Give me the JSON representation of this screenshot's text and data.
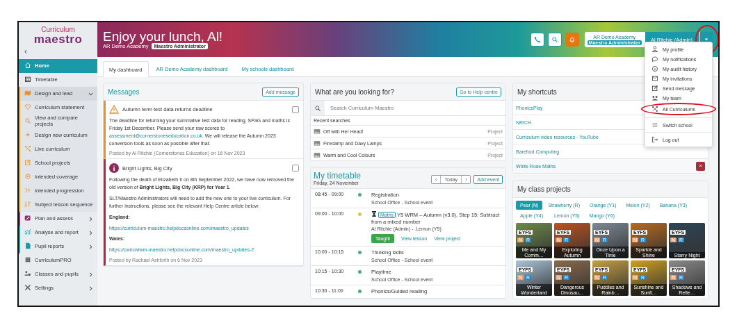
{
  "sidebar": {
    "logo": {
      "top": "Curriculum",
      "bottom": "maestro"
    },
    "collapse": "‹",
    "items": [
      {
        "label": "Home",
        "kind": "link",
        "selected": true
      },
      {
        "label": "Timetable",
        "kind": "link",
        "selected": false
      },
      {
        "label": "Design and lead",
        "kind": "group",
        "selected": false,
        "expanded": true,
        "color": "#e8912d"
      },
      {
        "label": "Curriculum statement",
        "kind": "sub",
        "selected": false
      },
      {
        "label": "View and compare projects",
        "kind": "sub",
        "selected": false
      },
      {
        "label": "Design new curriculum",
        "kind": "sub",
        "selected": false
      },
      {
        "label": "Live curriculum",
        "kind": "sub",
        "selected": false
      },
      {
        "label": "School projects",
        "kind": "sub",
        "selected": false
      },
      {
        "label": "Intended coverage",
        "kind": "sub",
        "selected": false
      },
      {
        "label": "Intended progression",
        "kind": "sub",
        "selected": false
      },
      {
        "label": "Subject lesson sequence",
        "kind": "sub",
        "selected": false
      },
      {
        "label": "Plan and assess",
        "kind": "group",
        "selected": false,
        "expanded": false,
        "color": "#8e2a6e"
      },
      {
        "label": "Analyse and report",
        "kind": "group",
        "selected": false,
        "expanded": false,
        "color": "#1a9aa8"
      },
      {
        "label": "Pupil reports",
        "kind": "group",
        "selected": false,
        "expanded": false,
        "color": "#1a9aa8"
      },
      {
        "label": "CurriculumPRO",
        "kind": "link",
        "selected": false
      },
      {
        "label": "Classes and pupils",
        "kind": "group",
        "selected": false,
        "expanded": false,
        "color": "#e9ecef"
      },
      {
        "label": "Settings",
        "kind": "group",
        "selected": false,
        "expanded": false,
        "color": "#e9ecef"
      }
    ]
  },
  "header": {
    "greeting": "Enjoy your lunch, Al!",
    "school": "AR Demo Academy",
    "role": "Maestro Administrator",
    "account": {
      "school": "AR Demo Academy",
      "role": "Maestro Administrator",
      "user": "Al Ritchie (Admin)",
      "menu_open": true,
      "highlighted": true
    }
  },
  "user_menu": {
    "sections": [
      [
        {
          "label": "My profile",
          "highlighted": false
        },
        {
          "label": "My notifications",
          "highlighted": false
        },
        {
          "label": "My audit history",
          "highlighted": false
        },
        {
          "label": "My invitations",
          "highlighted": false
        },
        {
          "label": "Send message",
          "highlighted": false
        },
        {
          "label": "My team",
          "highlighted": false
        },
        {
          "label": "All Curriculums",
          "highlighted": true
        }
      ],
      [
        {
          "label": "Switch school",
          "highlighted": false
        }
      ],
      [
        {
          "label": "Log out",
          "highlighted": false
        }
      ]
    ]
  },
  "tabs": [
    {
      "label": "My dashboard",
      "selected": true
    },
    {
      "label": "AR Demo Academy dashboard",
      "selected": false
    },
    {
      "label": "My schools dashboard",
      "selected": false
    }
  ],
  "messages": {
    "title": "Messages",
    "add_button": "Add message",
    "items": [
      {
        "kind": "warning",
        "title": "Autumn term test data returns deadline",
        "checked": false,
        "paragraphs": [
          [
            {
              "kind": "text",
              "text": "The deadline for returning your summative test data for reading, SPaG and maths is Friday 1st December. Please send your raw scores to "
            },
            {
              "kind": "link",
              "text": "assessment@cornerstoneseducation.co.uk"
            },
            {
              "kind": "text",
              "text": ". We will release the Autumn 2023 conversion tools as soon as possible after that."
            }
          ]
        ],
        "posted": "Posted by Al Ritchie (Cornerstones Education) on 16 Nov 2023"
      },
      {
        "kind": "info",
        "title": "Bright Lights, Big City",
        "checked": false,
        "paragraphs": [
          [
            {
              "kind": "text",
              "text": "Following the death of Elizabeth II on 8th September 2022, we have now removed the old version of **Bright Lights, Big City (KRP) for Year 1**."
            }
          ],
          [
            {
              "kind": "text",
              "text": "SLT/Maestro Administrators will need to add the new one to your live curriculum. For further instructions, please see the relevant Help Centre article below:"
            }
          ],
          [
            {
              "kind": "heading",
              "text": "England:"
            }
          ],
          [
            {
              "kind": "link",
              "text": "https://curriculum-maestro.helpdocsonline.com/maestro_updates"
            }
          ],
          [
            {
              "kind": "heading",
              "text": "Wales:"
            }
          ],
          [
            {
              "kind": "link",
              "text": "https://cwricwlwm-maestro.helpdocsonline.com/maestro_updates-2"
            }
          ]
        ],
        "posted": "Posted by Rachael Ashforth on 6 Nov 2023"
      }
    ]
  },
  "search": {
    "title": "What are you looking for?",
    "help_button": "Go to Help centre",
    "placeholder": "Search Curriculum Maestro",
    "recent_label": "Recent searches",
    "recent": [
      {
        "title": "Off with Her Head!",
        "type": "Project"
      },
      {
        "title": "Firedamp and Davy Lamps",
        "type": "Project"
      },
      {
        "title": "Warm and Cool Colours",
        "type": "Project"
      }
    ]
  },
  "timetable": {
    "title": "My timetable",
    "date": "Friday, 24 November",
    "prev": "‹",
    "today": "Today",
    "next": "›",
    "add_button": "Add event",
    "events": [
      {
        "kind": "event",
        "time": "08:45 - 09:00",
        "color": "#3cb371",
        "title": "Registration",
        "subtitle": "School Office - School event"
      },
      {
        "kind": "lesson",
        "time": "09:00 - 10:00",
        "color": "#d4d21c",
        "subject": "Maths",
        "title": "Y5 WRM – Autumn (v3.0), Step 15: Subtract from a mixed number",
        "subtitle": "Al Ritchie (Admin) - .Lemon (Y5)",
        "status": "Taught",
        "links": [
          "View lesson",
          "View project"
        ]
      },
      {
        "kind": "event",
        "time": "10:00 - 10:15",
        "color": "#3cb371",
        "title": "Thinking skills",
        "subtitle": "School Office - School event"
      },
      {
        "kind": "event",
        "time": "10:15 - 10:30",
        "color": "#3cb371",
        "title": "Playtime",
        "subtitle": "School Office - School event"
      },
      {
        "kind": "event",
        "time": "10:30 - 11:00",
        "color": "#3cb371",
        "title": "Phonics/Guided reading"
      }
    ]
  },
  "shortcuts": {
    "title": "My shortcuts",
    "items": [
      {
        "label": "PhonicsPlay",
        "hovered": false
      },
      {
        "label": "NRICH",
        "hovered": false
      },
      {
        "label": "Curriculum video resources - YouTube",
        "hovered": false
      },
      {
        "label": "Barefoot Computing",
        "hovered": false
      },
      {
        "label": "White Rose Maths",
        "hovered": true
      }
    ],
    "delete": "×"
  },
  "class_projects": {
    "title": "My class projects",
    "classes": [
      {
        "label": "Pear (N)",
        "selected": true
      },
      {
        "label": "Strawberry (R)",
        "selected": false
      },
      {
        "label": "Orange (Y1)",
        "selected": false
      },
      {
        "label": "Melon (Y2)",
        "selected": false
      },
      {
        "label": "Banana (Y3)",
        "selected": false
      },
      {
        "label": "Apple (Y4)",
        "selected": false
      },
      {
        "label": ".Lemon (Y5)",
        "selected": false
      },
      {
        "label": "Mango (Y6)",
        "selected": false
      }
    ],
    "projects": [
      {
        "stage": "EYFS",
        "badges": [
          "N",
          "R"
        ],
        "title": "Me and My Comm…"
      },
      {
        "stage": "EYFS",
        "badges": [
          "N",
          "R"
        ],
        "title": "Exploring Autumn"
      },
      {
        "stage": "EYFS",
        "badges": [
          "N",
          "R"
        ],
        "title": "Once Upon a Time"
      },
      {
        "stage": "EYFS",
        "badges": [
          "N",
          "R"
        ],
        "title": "Sparkle and Shine"
      },
      {
        "stage": "EYFS",
        "badges": [
          "N",
          "R"
        ],
        "title": "Starry Night"
      },
      {
        "stage": "EYFS",
        "badges": [
          "N",
          "R"
        ],
        "title": "Winter Wonderland"
      },
      {
        "stage": "EYFS",
        "badges": [
          "N",
          "R"
        ],
        "title": "Dangerous Dinosau…"
      },
      {
        "stage": "EYFS",
        "badges": [
          "N",
          "R"
        ],
        "title": "Puddles and Rainb…"
      },
      {
        "stage": "EYFS",
        "badges": [
          "N",
          "R"
        ],
        "title": "Sunshine and Sunfl…"
      },
      {
        "stage": "EYFS",
        "badges": [
          "N",
          "R"
        ],
        "title": "Shadows and Refle…"
      }
    ]
  }
}
